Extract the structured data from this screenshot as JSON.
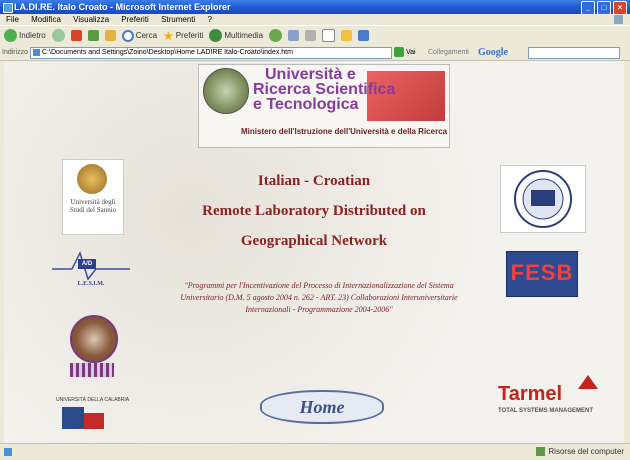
{
  "window": {
    "title": "LA.DI.RE. Italo Croato - Microsoft Internet Explorer"
  },
  "menu": [
    "File",
    "Modifica",
    "Visualizza",
    "Preferiti",
    "Strumenti",
    "?"
  ],
  "toolbar": {
    "back": "Indietro",
    "search": "Cerca",
    "favorites": "Preferiti",
    "multimedia": "Multimedia"
  },
  "address": {
    "label": "Indirizzo",
    "url": "C:\\Documents and Settings\\Zoino\\Desktop\\Home LADIRE Italo-Croato\\index.htm",
    "go": "Vai",
    "links": "Collegamenti",
    "google": "Google"
  },
  "banner": {
    "line1": "Università e",
    "line2": "Ricerca Scientifica",
    "line3": "e Tecnologica",
    "subtitle": "Ministero dell'Istruzione dell'Università e della Ricerca"
  },
  "logos": {
    "sannio": "Università degli Studi del Sannio",
    "lesim": "L.E.S.I.M.",
    "lesim_mark": "A/D",
    "fesb": "FESB",
    "bottom_left": "UNIVERSITÀ DELLA CALABRIA"
  },
  "headline": {
    "line1": "Italian - Croatian",
    "line2": "Remote Laboratory Distributed on",
    "line3": "Geographical Network"
  },
  "description": "\"Programmi per l'Incentivazione del Processo di Internazionalizzazione del Sistema Universitario (D.M. 5 agosto 2004 n. 262 - ART. 23) Collaborazioni Interuniversitarie Internazionali - Programmazione 2004-2006\"",
  "home_label": "Home",
  "tarmel": {
    "name": "Tarmel",
    "tagline": "TOTAL SYSTEMS MANAGEMENT"
  },
  "status": {
    "zone": "Risorse del computer"
  }
}
